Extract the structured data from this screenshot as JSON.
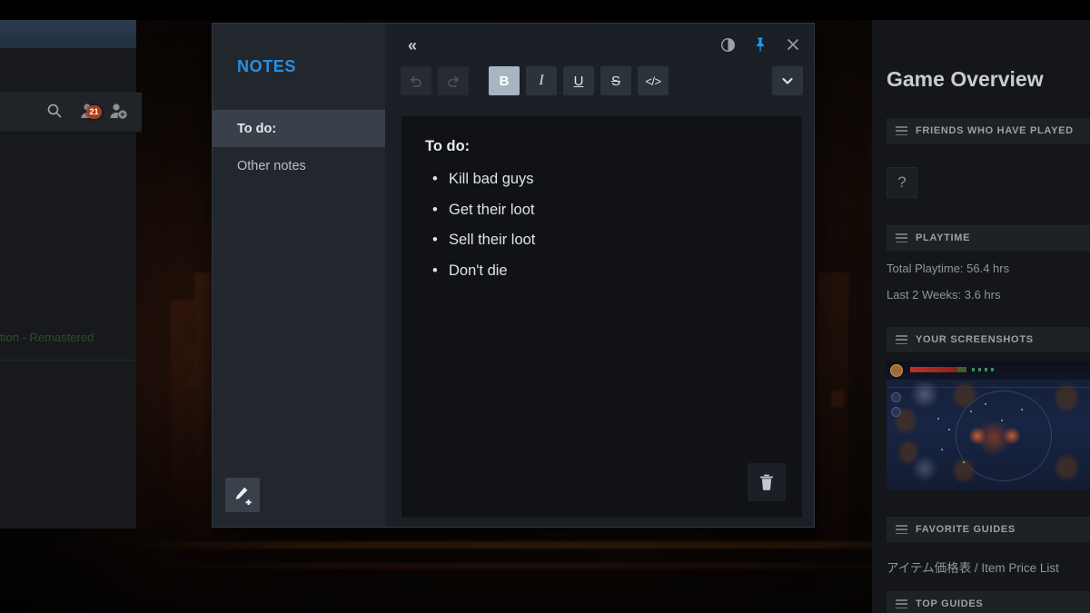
{
  "background_window": {
    "close_icon": "close-icon",
    "gear_icon": "gear-icon",
    "search_icon": "search-icon",
    "friends_icon": "friends-icon",
    "add_friend_icon": "add-friend-icon",
    "friends_badge_count": "21",
    "library_entry_text": "tion - Remastered"
  },
  "notes_window": {
    "sidebar": {
      "header": "NOTES",
      "items": [
        {
          "label": "To do:",
          "selected": true
        },
        {
          "label": "Other notes",
          "selected": false
        }
      ],
      "new_note_icon": "new-note-pencil-icon"
    },
    "titlebar": {
      "collapse_icon": "collapse-left-chevrons-icon",
      "collapse_glyph": "«",
      "contrast_icon": "contrast-toggle-icon",
      "pin_icon": "pin-icon",
      "pin_color": "#1a9fff",
      "close_icon": "close-icon",
      "close_glyph": "×"
    },
    "toolbar": {
      "undo": {
        "name": "undo-button",
        "glyph": "↶",
        "state": "disabled"
      },
      "redo": {
        "name": "redo-button",
        "glyph": "↷",
        "state": "disabled"
      },
      "bold": {
        "name": "bold-button",
        "glyph": "B",
        "state": "active"
      },
      "italic": {
        "name": "italic-button",
        "glyph": "I",
        "state": "normal"
      },
      "underline": {
        "name": "underline-button",
        "glyph": "U",
        "state": "normal"
      },
      "strikethrough": {
        "name": "strikethrough-button",
        "glyph": "S",
        "state": "normal"
      },
      "code": {
        "name": "code-button",
        "glyph": "</>",
        "state": "normal"
      },
      "more": {
        "name": "more-options-button",
        "glyph": "⌄",
        "state": "normal"
      }
    },
    "editor": {
      "title": "To do:",
      "bullets": [
        "Kill bad guys",
        "Get their loot",
        "Sell their loot",
        "Don't die"
      ],
      "delete_icon": "trash-icon"
    }
  },
  "right_sidebar": {
    "title": "Game Overview",
    "sections": [
      {
        "label": "FRIENDS WHO HAVE PLAYED",
        "grip_icon": "grip-handle-icon"
      },
      {
        "label": "PLAYTIME",
        "grip_icon": "grip-handle-icon"
      },
      {
        "label": "YOUR SCREENSHOTS",
        "grip_icon": "grip-handle-icon"
      },
      {
        "label": "FAVORITE GUIDES",
        "grip_icon": "grip-handle-icon"
      },
      {
        "label": "TOP GUIDES",
        "grip_icon": "grip-handle-icon"
      }
    ],
    "friend_avatar_placeholder": "?",
    "playtime": {
      "total": "Total Playtime: 56.4 hrs",
      "last_two_weeks": "Last 2 Weeks: 3.6 hrs"
    },
    "favorite_guide": "アイテム価格表 / Item Price List"
  },
  "colors": {
    "accent_blue": "#2a8fe0",
    "pin_blue": "#1a9fff",
    "notes_panel_bg": "#1b2026",
    "notes_sidebar_bg": "#22272e",
    "editor_bg": "#101215",
    "badge_red": "#a8401a"
  }
}
